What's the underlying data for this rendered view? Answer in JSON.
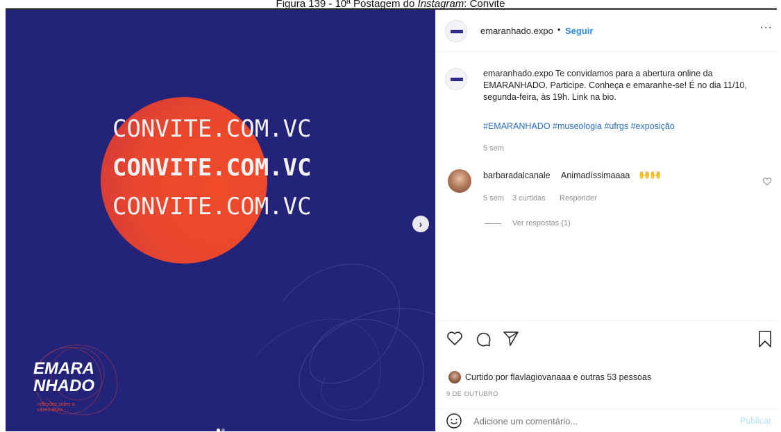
{
  "caption": {
    "text_prefix": "Figura 139 - 10ª Postagem do ",
    "text_italic": "Instagram",
    "text_suffix": ": Convite"
  },
  "post_image": {
    "line1": "CONVITE.COM.VC",
    "line2": "CONVITE.COM.VC",
    "line3": "CONVITE.COM.VC",
    "logo_line1": "EMARA",
    "logo_line2": "NHADO",
    "logo_subtitle": "reflexões sobre a cibercultura",
    "next_icon": "chevron-right-icon",
    "colors": {
      "background": "#23237a",
      "circle": "#e8462e"
    }
  },
  "header": {
    "username": "emaranhado.expo",
    "separator": "•",
    "follow_label": "Seguir",
    "more_icon": "more-horizontal-icon"
  },
  "post_caption": {
    "username": "emaranhado.expo",
    "text_l1": "Te convidamos para a abertura online da",
    "text_l2": "EMARANHADO. Participe. Conheça e emaranhe-se! É no dia 11/10,",
    "text_l3": "segunda-feira, às 19h. Link na bio.",
    "hashtags": "#EMARANHADO #museologia #ufrgs #exposição",
    "time": "5 sem"
  },
  "comment": {
    "username": "barbaradalcanale",
    "text": "Animadíssimaaaa",
    "emoji": "🙌🙌",
    "time": "5 sem",
    "likes": "3 curtidas",
    "reply_label": "Responder",
    "view_replies": "Ver respostas (1)"
  },
  "actions": {
    "like_icon": "heart-icon",
    "comment_icon": "comment-icon",
    "share_icon": "send-icon",
    "save_icon": "bookmark-icon"
  },
  "likes": {
    "prefix": "Curtido por ",
    "user": "flavlagiovanaaa",
    "middle": " e ",
    "others": "outras 53 pessoas"
  },
  "date": "9 DE OUTUBRO",
  "add_comment": {
    "placeholder": "Adicione um comentário...",
    "publish_label": "Publicar",
    "emoji_icon": "smiley-icon"
  }
}
